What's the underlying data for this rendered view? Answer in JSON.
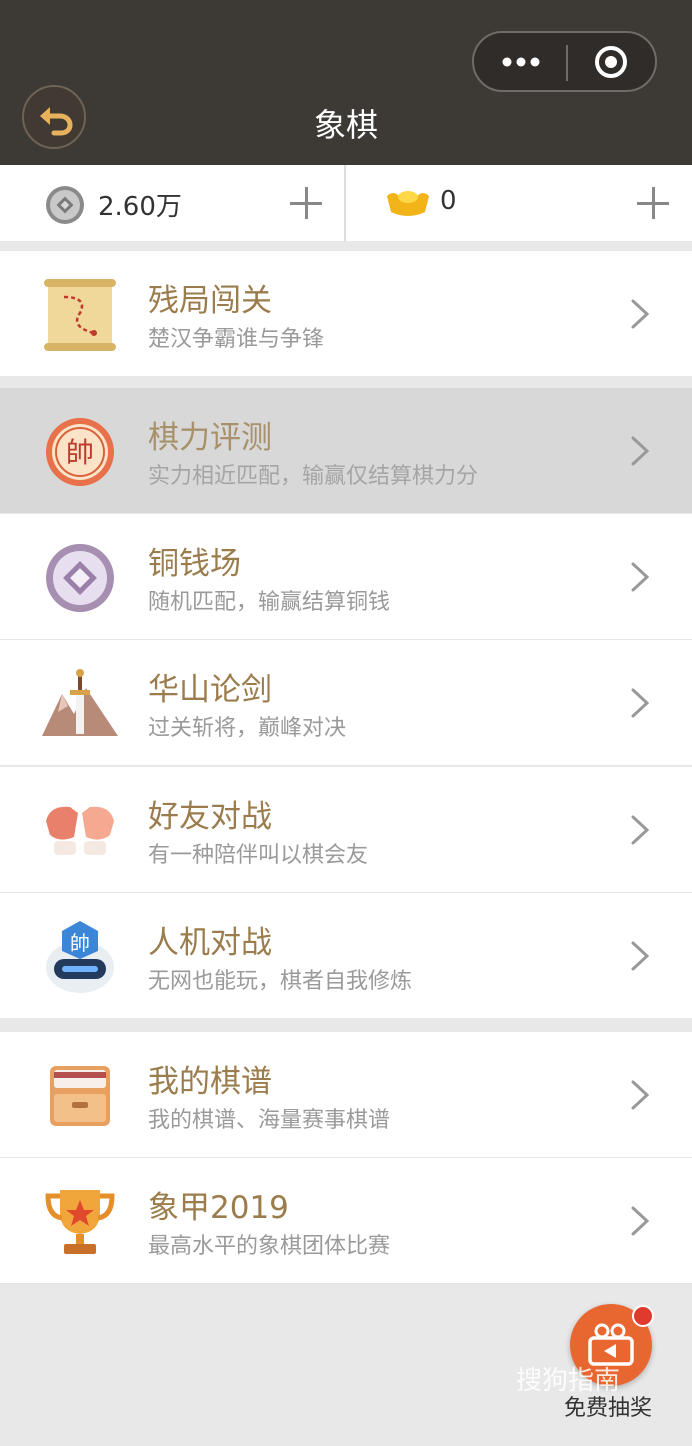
{
  "header": {
    "title": "象棋",
    "back_icon": "undo-arrow-icon",
    "menu_icon": "more-dots-icon",
    "close_icon": "target-circle-icon"
  },
  "balance": {
    "coins": "2.60万",
    "gold": "0"
  },
  "menu_groups": [
    [
      {
        "title": "残局闯关",
        "subtitle": "楚汉争霸谁与争锋",
        "icon": "scroll-map-icon"
      }
    ],
    [
      {
        "title": "棋力评测",
        "subtitle": "实力相近匹配，输赢仅结算棋力分",
        "icon": "shuai-chess-piece-icon",
        "active": true
      },
      {
        "title": "铜钱场",
        "subtitle": "随机匹配，输赢结算铜钱",
        "icon": "copper-coin-icon"
      },
      {
        "title": "华山论剑",
        "subtitle": "过关斩将，巅峰对决",
        "icon": "mountain-sword-icon"
      },
      {
        "title": "好友对战",
        "subtitle": "有一种陪伴叫以棋会友",
        "icon": "fist-bump-icon"
      },
      {
        "title": "人机对战",
        "subtitle": "无网也能玩，棋者自我修炼",
        "icon": "robot-helmet-icon"
      }
    ],
    [
      {
        "title": "我的棋谱",
        "subtitle": "我的棋谱、海量赛事棋谱",
        "icon": "record-box-icon"
      },
      {
        "title": "象甲2019",
        "subtitle": "最高水平的象棋团体比赛",
        "icon": "trophy-icon"
      }
    ]
  ],
  "fab": {
    "label": "免费抽奖",
    "icon": "video-camera-icon"
  },
  "watermark": "搜狗指南",
  "colors": {
    "header_bg": "#3d3a36",
    "title_text": "#9b7c4c",
    "subtitle_text": "#9a9a9a",
    "fab_bg": "#e8662f",
    "page_bg": "#e8e8e8"
  }
}
